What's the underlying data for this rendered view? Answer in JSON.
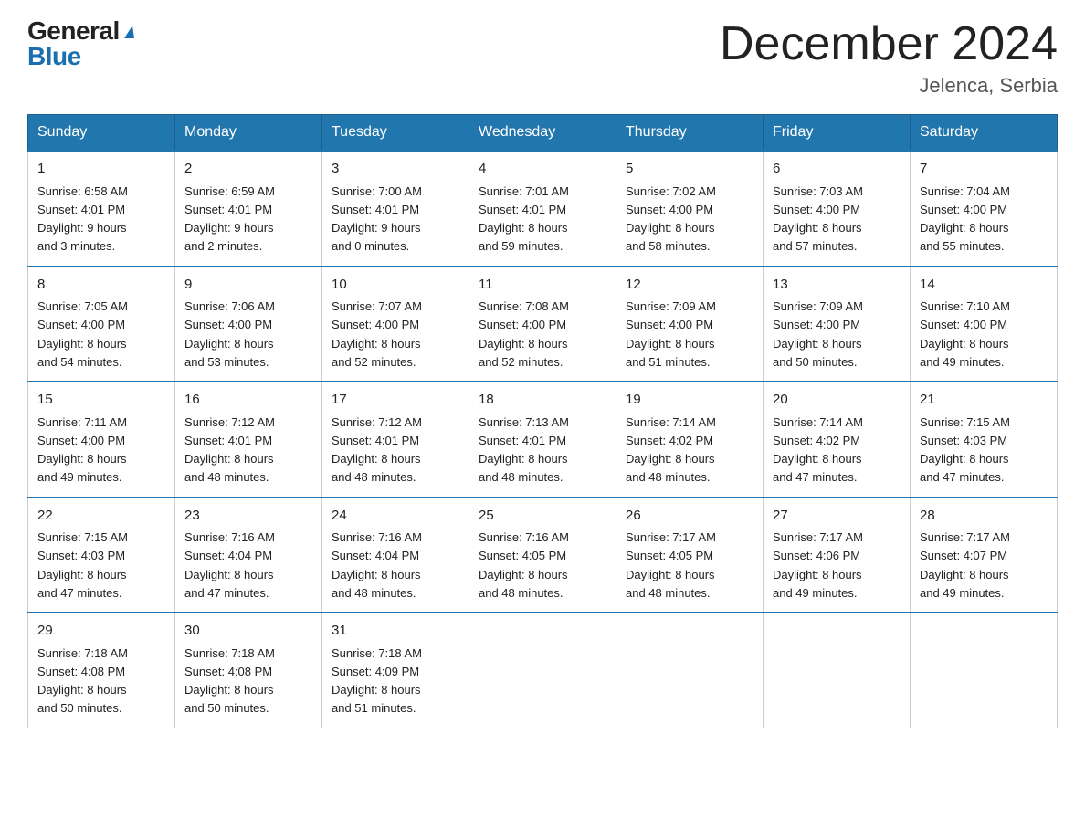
{
  "logo": {
    "general": "General",
    "blue": "Blue",
    "triangle": "▶"
  },
  "title": {
    "month_year": "December 2024",
    "location": "Jelenca, Serbia"
  },
  "days_of_week": [
    "Sunday",
    "Monday",
    "Tuesday",
    "Wednesday",
    "Thursday",
    "Friday",
    "Saturday"
  ],
  "weeks": [
    [
      {
        "day": "1",
        "sunrise": "6:58 AM",
        "sunset": "4:01 PM",
        "daylight": "9 hours and 3 minutes."
      },
      {
        "day": "2",
        "sunrise": "6:59 AM",
        "sunset": "4:01 PM",
        "daylight": "9 hours and 2 minutes."
      },
      {
        "day": "3",
        "sunrise": "7:00 AM",
        "sunset": "4:01 PM",
        "daylight": "9 hours and 0 minutes."
      },
      {
        "day": "4",
        "sunrise": "7:01 AM",
        "sunset": "4:01 PM",
        "daylight": "8 hours and 59 minutes."
      },
      {
        "day": "5",
        "sunrise": "7:02 AM",
        "sunset": "4:00 PM",
        "daylight": "8 hours and 58 minutes."
      },
      {
        "day": "6",
        "sunrise": "7:03 AM",
        "sunset": "4:00 PM",
        "daylight": "8 hours and 57 minutes."
      },
      {
        "day": "7",
        "sunrise": "7:04 AM",
        "sunset": "4:00 PM",
        "daylight": "8 hours and 55 minutes."
      }
    ],
    [
      {
        "day": "8",
        "sunrise": "7:05 AM",
        "sunset": "4:00 PM",
        "daylight": "8 hours and 54 minutes."
      },
      {
        "day": "9",
        "sunrise": "7:06 AM",
        "sunset": "4:00 PM",
        "daylight": "8 hours and 53 minutes."
      },
      {
        "day": "10",
        "sunrise": "7:07 AM",
        "sunset": "4:00 PM",
        "daylight": "8 hours and 52 minutes."
      },
      {
        "day": "11",
        "sunrise": "7:08 AM",
        "sunset": "4:00 PM",
        "daylight": "8 hours and 52 minutes."
      },
      {
        "day": "12",
        "sunrise": "7:09 AM",
        "sunset": "4:00 PM",
        "daylight": "8 hours and 51 minutes."
      },
      {
        "day": "13",
        "sunrise": "7:09 AM",
        "sunset": "4:00 PM",
        "daylight": "8 hours and 50 minutes."
      },
      {
        "day": "14",
        "sunrise": "7:10 AM",
        "sunset": "4:00 PM",
        "daylight": "8 hours and 49 minutes."
      }
    ],
    [
      {
        "day": "15",
        "sunrise": "7:11 AM",
        "sunset": "4:00 PM",
        "daylight": "8 hours and 49 minutes."
      },
      {
        "day": "16",
        "sunrise": "7:12 AM",
        "sunset": "4:01 PM",
        "daylight": "8 hours and 48 minutes."
      },
      {
        "day": "17",
        "sunrise": "7:12 AM",
        "sunset": "4:01 PM",
        "daylight": "8 hours and 48 minutes."
      },
      {
        "day": "18",
        "sunrise": "7:13 AM",
        "sunset": "4:01 PM",
        "daylight": "8 hours and 48 minutes."
      },
      {
        "day": "19",
        "sunrise": "7:14 AM",
        "sunset": "4:02 PM",
        "daylight": "8 hours and 48 minutes."
      },
      {
        "day": "20",
        "sunrise": "7:14 AM",
        "sunset": "4:02 PM",
        "daylight": "8 hours and 47 minutes."
      },
      {
        "day": "21",
        "sunrise": "7:15 AM",
        "sunset": "4:03 PM",
        "daylight": "8 hours and 47 minutes."
      }
    ],
    [
      {
        "day": "22",
        "sunrise": "7:15 AM",
        "sunset": "4:03 PM",
        "daylight": "8 hours and 47 minutes."
      },
      {
        "day": "23",
        "sunrise": "7:16 AM",
        "sunset": "4:04 PM",
        "daylight": "8 hours and 47 minutes."
      },
      {
        "day": "24",
        "sunrise": "7:16 AM",
        "sunset": "4:04 PM",
        "daylight": "8 hours and 48 minutes."
      },
      {
        "day": "25",
        "sunrise": "7:16 AM",
        "sunset": "4:05 PM",
        "daylight": "8 hours and 48 minutes."
      },
      {
        "day": "26",
        "sunrise": "7:17 AM",
        "sunset": "4:05 PM",
        "daylight": "8 hours and 48 minutes."
      },
      {
        "day": "27",
        "sunrise": "7:17 AM",
        "sunset": "4:06 PM",
        "daylight": "8 hours and 49 minutes."
      },
      {
        "day": "28",
        "sunrise": "7:17 AM",
        "sunset": "4:07 PM",
        "daylight": "8 hours and 49 minutes."
      }
    ],
    [
      {
        "day": "29",
        "sunrise": "7:18 AM",
        "sunset": "4:08 PM",
        "daylight": "8 hours and 50 minutes."
      },
      {
        "day": "30",
        "sunrise": "7:18 AM",
        "sunset": "4:08 PM",
        "daylight": "8 hours and 50 minutes."
      },
      {
        "day": "31",
        "sunrise": "7:18 AM",
        "sunset": "4:09 PM",
        "daylight": "8 hours and 51 minutes."
      },
      null,
      null,
      null,
      null
    ]
  ],
  "labels": {
    "sunrise": "Sunrise:",
    "sunset": "Sunset:",
    "daylight": "Daylight:"
  },
  "colors": {
    "header_bg": "#2176ae",
    "header_text": "#ffffff",
    "border_top": "#2176ae"
  }
}
